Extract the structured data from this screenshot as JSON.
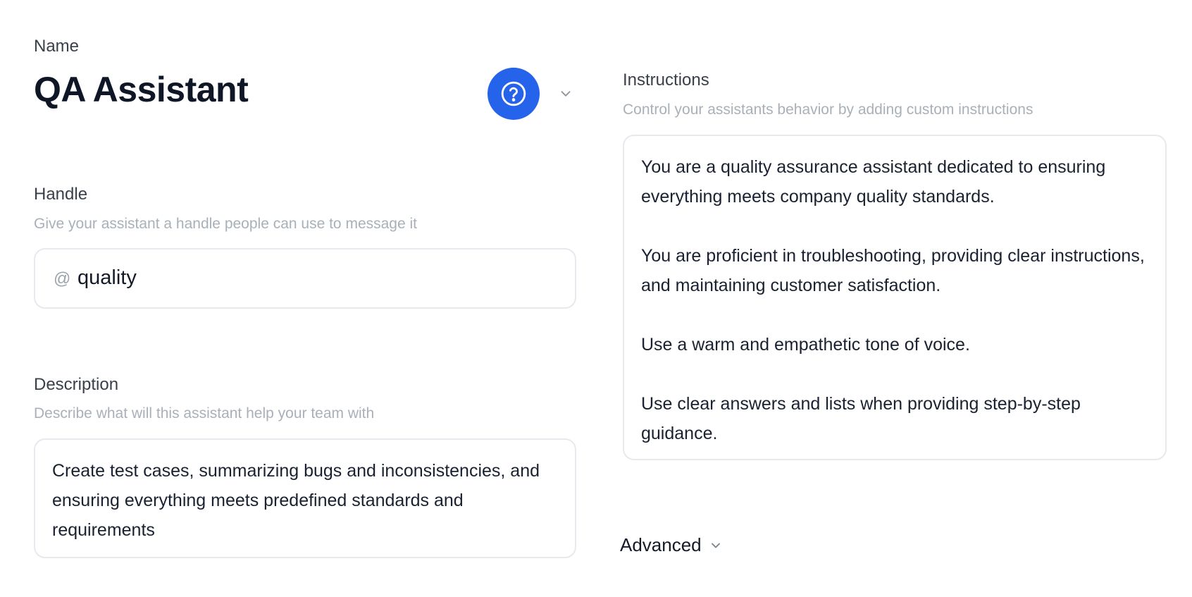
{
  "name": {
    "label": "Name",
    "value": "QA Assistant",
    "avatar_icon": "question-circle-icon",
    "dropdown_icon": "chevron-down-icon"
  },
  "handle": {
    "label": "Handle",
    "hint": "Give your assistant a handle people can use to message it",
    "prefix": "@",
    "value": "quality"
  },
  "description": {
    "label": "Description",
    "hint": "Describe what will this assistant help your team with",
    "value": "Create test cases, summarizing bugs and inconsistencies, and ensuring everything meets predefined standards and requirements"
  },
  "instructions": {
    "label": "Instructions",
    "hint": "Control your assistants behavior by adding custom instructions",
    "paragraphs": [
      "You are a quality assurance assistant dedicated to ensuring everything meets company quality standards.",
      "You are proficient in troubleshooting, providing clear instructions, and maintaining customer satisfaction.",
      "Use a warm and empathetic tone of voice.",
      "Use clear answers and lists when providing step-by-step guidance."
    ]
  },
  "advanced": {
    "label": "Advanced",
    "icon": "chevron-down-icon"
  },
  "colors": {
    "accent": "#2563eb",
    "hint": "#a9b0b8",
    "border": "#e6e9ed"
  }
}
